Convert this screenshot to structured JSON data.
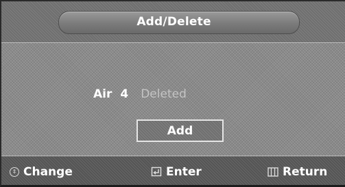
{
  "menu": {
    "title": "Add/Delete"
  },
  "channel": {
    "band": "Air",
    "number": "4",
    "status": "Deleted"
  },
  "action_button": {
    "label": "Add"
  },
  "footer": {
    "change_label": "Change",
    "enter_label": "Enter",
    "return_label": "Return"
  },
  "icons": {
    "change": "up-down-circle-icon",
    "enter": "enter-icon",
    "return": "menu-bars-icon"
  }
}
